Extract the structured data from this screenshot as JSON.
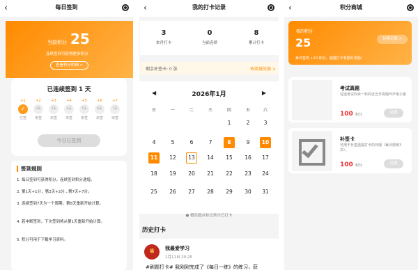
{
  "signin": {
    "title": "每日签到",
    "points_label": "当前积分",
    "points": "25",
    "hint": "连续签到可获得更多积分",
    "details_button": "查看积分明细 >",
    "streak_title": "已连续签到 1 天",
    "days": [
      {
        "bonus": "+1",
        "label": "",
        "state": "已签"
      },
      {
        "bonus": "+2",
        "label": "2天",
        "state": "未签"
      },
      {
        "bonus": "+3",
        "label": "3天",
        "state": "未签"
      },
      {
        "bonus": "+4",
        "label": "4天",
        "state": "未签"
      },
      {
        "bonus": "+5",
        "label": "5天",
        "state": "未签"
      },
      {
        "bonus": "+6",
        "label": "6天",
        "state": "未签"
      },
      {
        "bonus": "+7",
        "label": "7天",
        "state": "未签"
      }
    ],
    "signed_button": "今日已签到",
    "rules_title": "签到规则",
    "rules": [
      "1. 每日签到可获得积分，连续签到积分递增。",
      "2. 第1天+1分，第2天+2分...第7天+7分。",
      "3. 连续签到7天为一个周期，第8天重新开始计算。",
      "4. 若中断签到，下次签到将从第1天重新开始计算。",
      "5. 积分可用于下载学习资料。"
    ]
  },
  "records": {
    "title": "我的打卡记录",
    "stats": [
      {
        "value": "3",
        "label": "本月打卡"
      },
      {
        "value": "0",
        "label": "当前连续"
      },
      {
        "value": "8",
        "label": "累计打卡"
      }
    ],
    "makeup_left": "剩余补签卡: 0 张",
    "makeup_right": "去商城兑换 >",
    "month": "2026年1月",
    "prev": "◀",
    "next": "▶",
    "weekdays": [
      "日",
      "一",
      "二",
      "三",
      "四",
      "五",
      "六"
    ],
    "weeks": [
      [
        "",
        "",
        "",
        "",
        "1",
        "2",
        "3"
      ],
      [
        "4",
        "5",
        "6",
        "7",
        "8",
        "9",
        "10"
      ],
      [
        "11",
        "12",
        "13",
        "14",
        "15",
        "16",
        "17"
      ],
      [
        "18",
        "19",
        "20",
        "21",
        "22",
        "23",
        "24"
      ],
      [
        "25",
        "26",
        "27",
        "28",
        "29",
        "30",
        "31"
      ]
    ],
    "checked_days": [
      "8",
      "10",
      "11"
    ],
    "today": "13",
    "legend": "● 橙色圆点标记表示已打卡",
    "history_title": "历史打卡",
    "post": {
      "avatar": "福",
      "name": "我最爱学习",
      "time": "1月11日 20:25",
      "text": "#刷题打卡# 我刚刚完成了《每日一练》的练习，获"
    }
  },
  "mall": {
    "title": "积分商城",
    "points_label": "我的积分",
    "points": "25",
    "desc": "每日签到 +10 积分，越越打卡有额外奖励!",
    "records_button": "兑换记录 >",
    "items": [
      {
        "name": "考试真题",
        "desc": "任选考试科目一科的近五年真题PDF电子版",
        "price": "100",
        "unit": "积分",
        "redeem": "兑换"
      },
      {
        "name": "补签卡",
        "desc": "可用于补签遗漏打卡的日期（每月限用3次）。",
        "price": "100",
        "unit": "积分",
        "redeem": "兑换"
      }
    ]
  }
}
